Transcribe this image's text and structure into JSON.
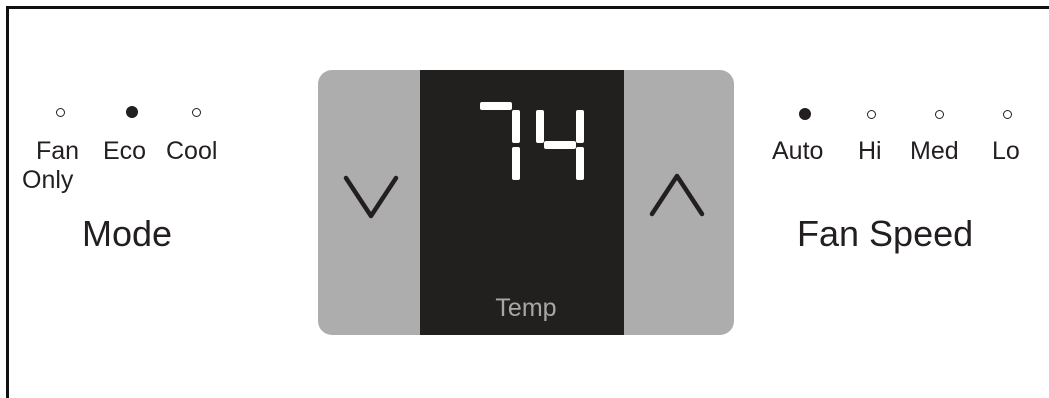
{
  "mode": {
    "title": "Mode",
    "options": [
      {
        "label": "Fan",
        "label2": "Only",
        "active": false
      },
      {
        "label": "Eco",
        "active": true
      },
      {
        "label": "Cool",
        "active": false
      }
    ]
  },
  "temp": {
    "value": "74",
    "label": "Temp"
  },
  "controls": {
    "down_icon": "chevron-down-icon",
    "up_icon": "chevron-up-icon"
  },
  "fan_speed": {
    "title": "Fan Speed",
    "options": [
      {
        "label": "Auto",
        "active": true
      },
      {
        "label": "Hi",
        "active": false
      },
      {
        "label": "Med",
        "active": false
      },
      {
        "label": "Lo",
        "active": false
      }
    ]
  },
  "colors": {
    "display_bg": "#221f1f",
    "button_bg": "#adadad",
    "segment_on": "#ffffff",
    "temp_label": "#a7a7a7"
  }
}
